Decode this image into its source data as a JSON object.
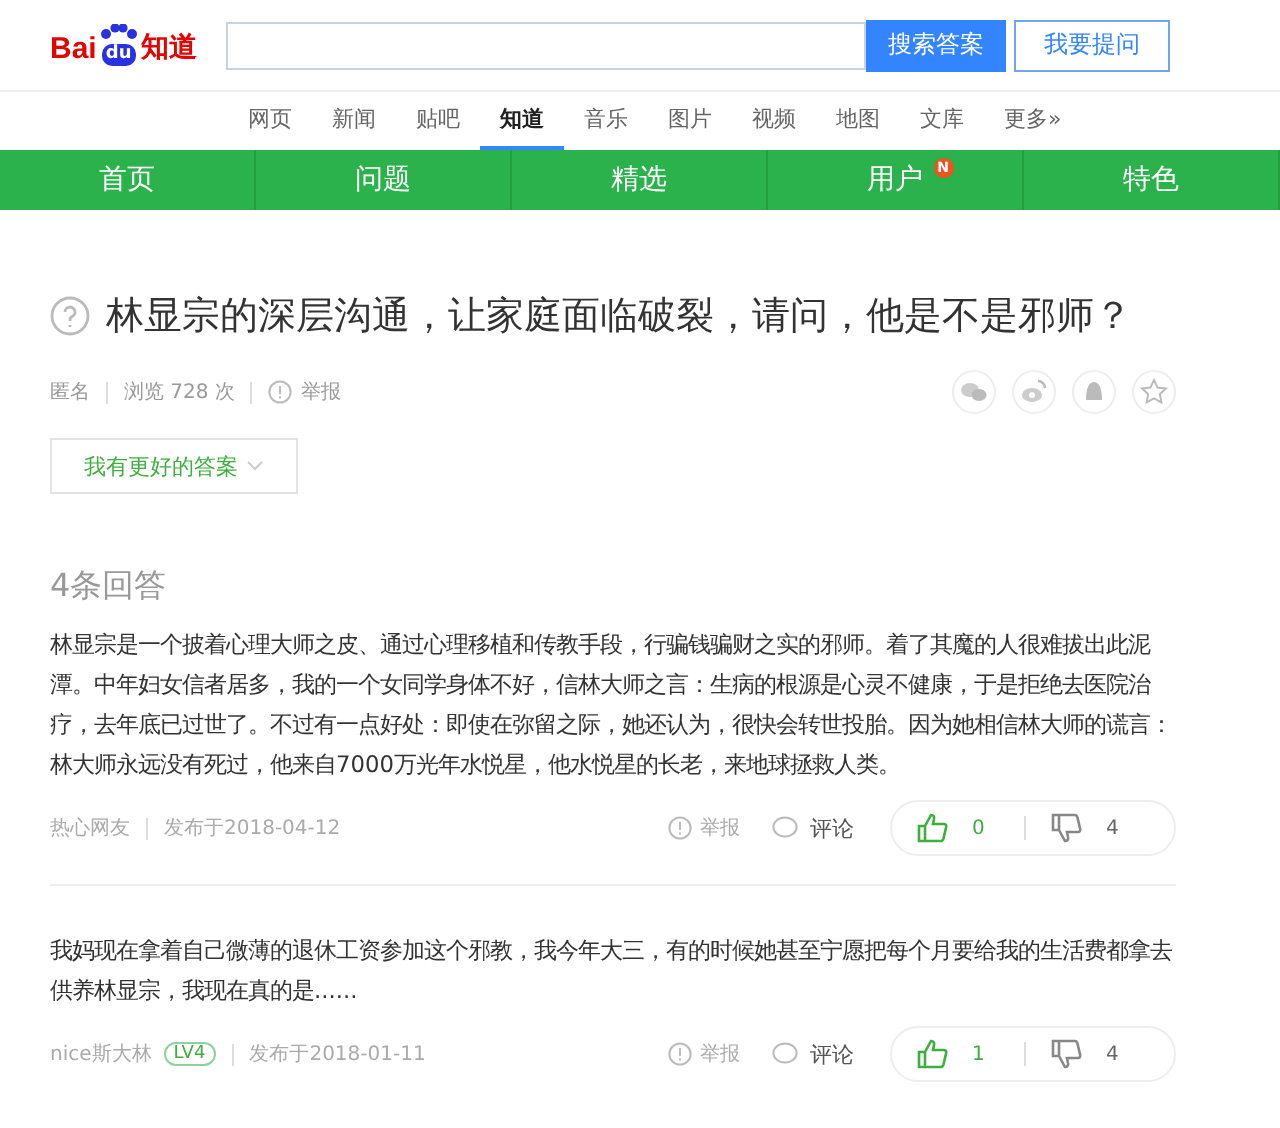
{
  "header": {
    "logo": {
      "left": "Bai",
      "badge": "du",
      "right": "知道"
    },
    "search": {
      "button": "搜索答案"
    },
    "ask_button": "我要提问"
  },
  "nav": [
    {
      "label": "网页",
      "selected": false
    },
    {
      "label": "新闻",
      "selected": false
    },
    {
      "label": "贴吧",
      "selected": false
    },
    {
      "label": "知道",
      "selected": true
    },
    {
      "label": "音乐",
      "selected": false
    },
    {
      "label": "图片",
      "selected": false
    },
    {
      "label": "视频",
      "selected": false
    },
    {
      "label": "地图",
      "selected": false
    },
    {
      "label": "文库",
      "selected": false
    },
    {
      "label": "更多»",
      "selected": false
    }
  ],
  "tabs": [
    {
      "label": "首页"
    },
    {
      "label": "问题"
    },
    {
      "label": "精选"
    },
    {
      "label": "用户",
      "badge": "N"
    },
    {
      "label": "特色"
    }
  ],
  "question": {
    "title": "林显宗的深层沟通，让家庭面临破裂，请问，他是不是邪师？",
    "author": "匿名",
    "views": "浏览 728 次",
    "report": "举报",
    "answer_button": "我有更好的答案"
  },
  "answers_heading": "4条回答",
  "answers": [
    {
      "text": "林显宗是一个披着心理大师之皮、通过心理移植和传教手段，行骗钱骗财之实的邪师。着了其魔的人很难拔出此泥潭。中年妇女信者居多，我的一个女同学身体不好，信林大师之言：生病的根源是心灵不健康，于是拒绝去医院治疗，去年底已过世了。不过有一点好处：即使在弥留之际，她还认为，很快会转世投胎。因为她相信林大师的谎言：林大师永远没有死过，他来自7000万光年水悦星，他水悦星的长老，来地球拯救人类。",
      "author": "热心网友",
      "date": "发布于2018-04-12",
      "report": "举报",
      "comment": "评论",
      "likes": "0",
      "dislikes": "4"
    },
    {
      "text": "我妈现在拿着自己微薄的退休工资参加这个邪教，我今年大三，有的时候她甚至宁愿把每个月要给我的生活费都拿去供养林显宗，我现在真的是......",
      "author": "nice斯大林",
      "level": "LV4",
      "date": "发布于2018-01-11",
      "report": "举报",
      "comment": "评论",
      "likes": "1",
      "dislikes": "4"
    }
  ]
}
